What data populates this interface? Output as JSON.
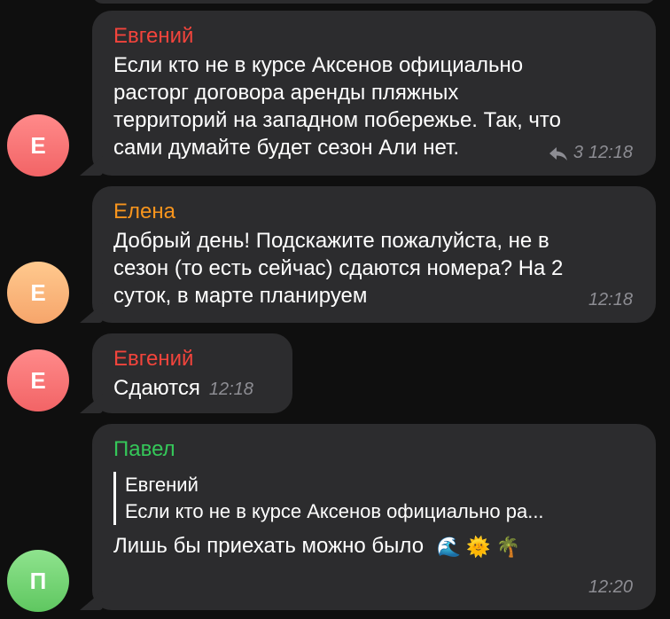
{
  "messages": [
    {
      "sender": "Евгений",
      "avatar_letter": "Е",
      "lines": [
        "Если кто не в курсе Аксенов официально",
        "расторг договора аренды пляжных",
        "территорий на западном побережье. Так, что",
        "сами думайте будет сезон Али нет."
      ],
      "reply_count": "3",
      "time": "12:18"
    },
    {
      "sender": "Елена",
      "avatar_letter": "Е",
      "lines": [
        "Добрый день! Подскажите пожалуйста, не в",
        "сезон (то есть сейчас) сдаются номера? На 2",
        "суток, в марте планируем"
      ],
      "time": "12:18"
    },
    {
      "sender": "Евгений",
      "avatar_letter": "Е",
      "text": "Сдаются",
      "time": "12:18"
    },
    {
      "sender": "Павел",
      "avatar_letter": "П",
      "quote": {
        "sender": "Евгений",
        "text": "Если кто не в курсе Аксенов официально ра..."
      },
      "text": "Лишь бы приехать можно было",
      "emojis": [
        "🌊",
        "🌞",
        "🌴"
      ],
      "time": "12:20"
    }
  ],
  "colors": {
    "background": "#0f0f0f",
    "bubble": "#2c2c2e",
    "sender_red": "#f2443c",
    "sender_orange": "#f8951d",
    "sender_green": "#35c759",
    "timestamp": "#8d8d93"
  },
  "icons": {
    "reply": "reply-arrow-icon"
  }
}
